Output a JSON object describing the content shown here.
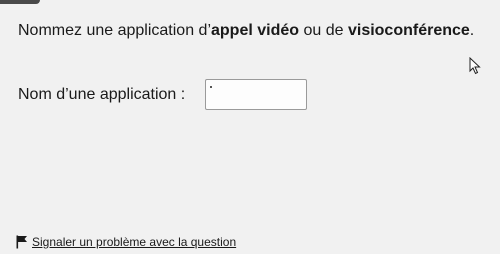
{
  "question": {
    "part1": "Nommez une application d’",
    "bold1": "appel vidéo",
    "part2": " ou de ",
    "bold2": "visioconférence",
    "part3": "."
  },
  "answer": {
    "label": "Nom d’une application :",
    "value": "",
    "placeholder": ""
  },
  "report": {
    "label": "Signaler un problème avec la question",
    "icon": "flag-icon"
  },
  "cursor": {
    "icon": "mouse-pointer-icon"
  }
}
